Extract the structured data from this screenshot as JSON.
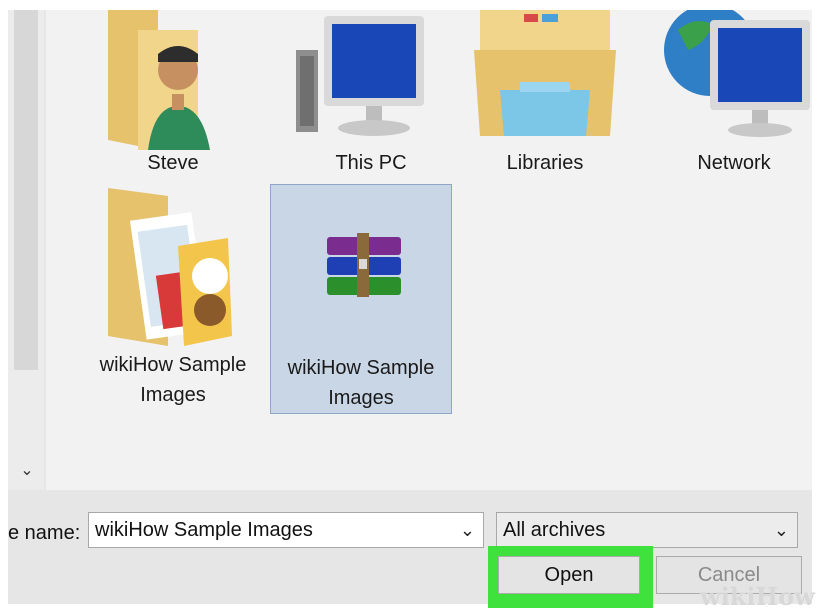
{
  "grid": {
    "items": [
      {
        "label": "Steve",
        "icon": "user-folder-icon"
      },
      {
        "label": "This PC",
        "icon": "computer-icon"
      },
      {
        "label": "Libraries",
        "icon": "libraries-folder-icon"
      },
      {
        "label": "Network",
        "icon": "network-icon"
      },
      {
        "label_line1": "wikiHow Sample",
        "label_line2": "Images",
        "icon": "image-folder-icon"
      },
      {
        "label_line1": "wikiHow Sample",
        "label_line2": "Images",
        "icon": "winrar-archive-icon",
        "selected": true
      }
    ]
  },
  "footer": {
    "file_name_label": "e name:",
    "file_name_value": "wikiHow Sample Images",
    "file_type_value": "All archives",
    "open_label": "Open",
    "cancel_label": "Cancel"
  },
  "watermark": "wikiHow",
  "colors": {
    "selection": "#c9d6e6",
    "highlight": "#3fe23c",
    "folder": "#e9c56f"
  }
}
